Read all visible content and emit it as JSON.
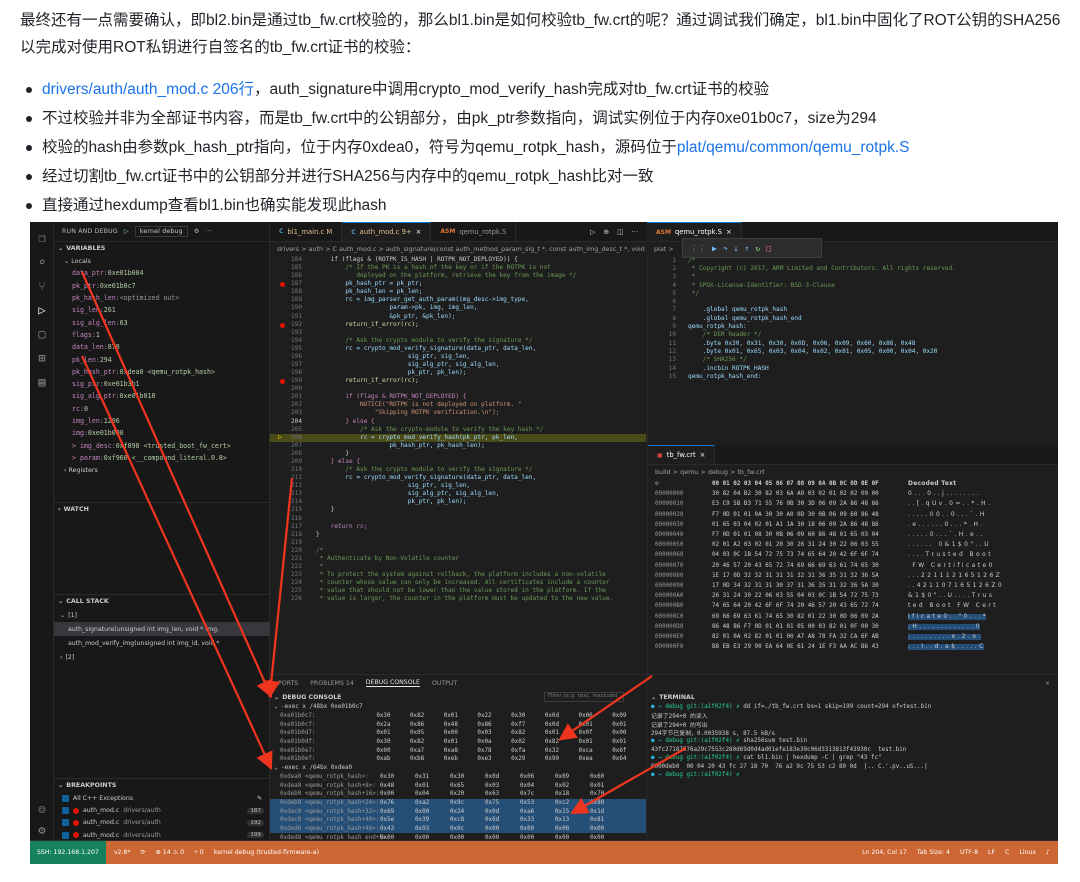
{
  "article": {
    "intro": "最终还有一点需要确认，即bl2.bin是通过tb_fw.crt校验的，那么bl1.bin是如何校验tb_fw.crt的呢？通过调试我们确定，bl1.bin中固化了ROT公钥的SHA256以完成对使用ROT私钥进行自签名的tb_fw.crt证书的校验：",
    "bullets": [
      {
        "link": "drivers/auth/auth_mod.c 206行",
        "text": "，auth_signature中调用crypto_mod_verify_hash完成对tb_fw.crt证书的校验",
        "link2": "",
        "tail": ""
      },
      {
        "link": "",
        "text": "不过校验并非为全部证书内容，而是tb_fw.crt中的公钥部分，由pk_ptr参数指向，调试实例位于内存0xe01b0c7，size为294",
        "link2": "",
        "tail": ""
      },
      {
        "link": "",
        "text": "校验的hash由参数pk_hash_ptr指向，位于内存0xdea0，符号为qemu_rotpk_hash，源码位于",
        "link2": "plat/qemu/common/qemu_rotpk.S",
        "tail": ""
      },
      {
        "link": "",
        "text": "经过切割tb_fw.crt证书中的公钥部分并进行SHA256与内存中的qemu_rotpk_hash比对一致",
        "link2": "",
        "tail": ""
      },
      {
        "link": "",
        "text": "直接通过hexdump查看bl1.bin也确实能发现此hash",
        "link2": "",
        "tail": ""
      }
    ]
  },
  "ide": {
    "run_label": "RUN AND DEBUG",
    "config": "kernel debug",
    "variables_title": "VARIABLES",
    "locals_title": "Locals",
    "locals": [
      {
        "n": "data_ptr",
        "v": "0xe01b004"
      },
      {
        "n": "pk_ptr",
        "v": "0xe01b0c7"
      },
      {
        "n": "pk_hash_len",
        "v": "<optimized out>"
      },
      {
        "n": "sig_len",
        "v": "261"
      },
      {
        "n": "sig_alg_len",
        "v": "63"
      },
      {
        "n": "flags",
        "v": "1"
      },
      {
        "n": "data_len",
        "v": "878"
      },
      {
        "n": "pk_len",
        "v": "294"
      },
      {
        "n": "pk_hash_ptr",
        "v": "0xdea0 <qemu_rotpk_hash>"
      },
      {
        "n": "sig_ptr",
        "v": "0xe01b3b1"
      },
      {
        "n": "sig_alg_ptr",
        "v": "0xe01b018"
      },
      {
        "n": "rc",
        "v": "0"
      },
      {
        "n": "img_len",
        "v": "1206"
      },
      {
        "n": "img",
        "v": "0xe01b000"
      },
      {
        "n": "> img_desc",
        "v": "0xf898 <trusted_boot_fw_cert>"
      },
      {
        "n": "> param",
        "v": "0xf960 <__compound_literal.0.8>"
      }
    ],
    "registers": "Registers",
    "watch": "WATCH",
    "callstack_title": "CALL STACK",
    "callstack_thread": "[1]",
    "callstack": [
      "auth_signature(unsigned int img_len, void * img,",
      "auth_mod_verify_img(unsigned int img_id, void *"
    ],
    "callstack_thread2": "[2]",
    "breakpoints_title": "BREAKPOINTS",
    "breakpoints": [
      {
        "label": "All C++ Exceptions",
        "path": "",
        "line": ""
      },
      {
        "label": "auth_mod.c",
        "path": "drivers/auth",
        "line": "187"
      },
      {
        "label": "auth_mod.c",
        "path": "drivers/auth",
        "line": "192"
      },
      {
        "label": "auth_mod.c",
        "path": "drivers/auth",
        "line": "199"
      },
      {
        "label": "auth_mod.c",
        "path": "drivers/auth",
        "line": "206"
      }
    ],
    "tabs": [
      "bl1_main.c M",
      "auth_mod.c 9+",
      "qemu_rotpk.S"
    ],
    "tab_right": "qemu_rotpk.S",
    "breadcrumb": "drivers > auth > C auth_mod.c > auth_signature(const auth_method_param_sig_t *, const auth_img_desc_t *, void *,",
    "breadcrumb_right": "plat >",
    "code": [
      {
        "n": "184",
        "t": "    if (flags & (ROTPK_IS_HASH | ROTPK_NOT_DEPLOYED)) {",
        "c": "pl"
      },
      {
        "n": "185",
        "t": "        /* If the PK is a hash of the key or if the ROTPK is not",
        "c": "cm"
      },
      {
        "n": "186",
        "t": "           deployed on the platform, retrieve the key from the image */",
        "c": "cm"
      },
      {
        "n": "187",
        "t": "        pk_hash_ptr = pk_ptr;",
        "c": "id",
        "bp": true
      },
      {
        "n": "188",
        "t": "        pk_hash_len = pk_len;",
        "c": "id"
      },
      {
        "n": "189",
        "t": "        rc = img_parser_get_auth_param(img_desc->img_type,",
        "c": "id"
      },
      {
        "n": "190",
        "t": "                    param->pk, img, img_len,",
        "c": "id"
      },
      {
        "n": "191",
        "t": "                    &pk_ptr, &pk_len);",
        "c": "id"
      },
      {
        "n": "192",
        "t": "        return_if_error(rc);",
        "c": "fn",
        "bp": true
      },
      {
        "n": "193",
        "t": "",
        "c": "pl"
      },
      {
        "n": "194",
        "t": "        /* Ask the crypto module to verify the signature */",
        "c": "cm"
      },
      {
        "n": "195",
        "t": "        rc = crypto_mod_verify_signature(data_ptr, data_len,",
        "c": "id"
      },
      {
        "n": "196",
        "t": "                         sig_ptr, sig_len,",
        "c": "id"
      },
      {
        "n": "197",
        "t": "                         sig_alg_ptr, sig_alg_len,",
        "c": "id"
      },
      {
        "n": "198",
        "t": "                         pk_ptr, pk_len);",
        "c": "id"
      },
      {
        "n": "199",
        "t": "        return_if_error(rc);",
        "c": "fn",
        "bp": true
      },
      {
        "n": "200",
        "t": "",
        "c": "pl"
      },
      {
        "n": "201",
        "t": "        if (flags & ROTPK_NOT_DEPLOYED) {",
        "c": "kw"
      },
      {
        "n": "202",
        "t": "            NOTICE(\"ROTPK is not deployed on platform. \"",
        "c": "st"
      },
      {
        "n": "203",
        "t": "                \"Skipping ROTPK verification.\\n\");",
        "c": "st"
      },
      {
        "n": "204",
        "t": "        } else {",
        "c": "kw"
      },
      {
        "n": "205",
        "t": "            /* Ask the crypto-module to verify the key hash */",
        "c": "cm"
      },
      {
        "n": "206",
        "t": "            rc = crypto_mod_verify_hash(pk_ptr, pk_len,",
        "c": "id",
        "hl": true
      },
      {
        "n": "207",
        "t": "                    pk_hash_ptr, pk_hash_len);",
        "c": "id"
      },
      {
        "n": "208",
        "t": "        }",
        "c": "pl"
      },
      {
        "n": "209",
        "t": "    } else {",
        "c": "kw"
      },
      {
        "n": "210",
        "t": "        /* Ask the crypto module to verify the signature */",
        "c": "cm"
      },
      {
        "n": "211",
        "t": "        rc = crypto_mod_verify_signature(data_ptr, data_len,",
        "c": "id"
      },
      {
        "n": "212",
        "t": "                         sig_ptr, sig_len,",
        "c": "id"
      },
      {
        "n": "213",
        "t": "                         sig_alg_ptr, sig_alg_len,",
        "c": "id"
      },
      {
        "n": "214",
        "t": "                         pk_ptr, pk_len);",
        "c": "id"
      },
      {
        "n": "215",
        "t": "    }",
        "c": "pl"
      },
      {
        "n": "216",
        "t": "",
        "c": "pl"
      },
      {
        "n": "217",
        "t": "    return rc;",
        "c": "kw"
      },
      {
        "n": "218",
        "t": "}",
        "c": "pl"
      },
      {
        "n": "219",
        "t": "",
        "c": "pl"
      },
      {
        "n": "220",
        "t": "/*",
        "c": "cm"
      },
      {
        "n": "221",
        "t": " * Authenticate by Non-Volatile counter",
        "c": "cm"
      },
      {
        "n": "222",
        "t": " *",
        "c": "cm"
      },
      {
        "n": "223",
        "t": " * To protect the system against rollback, the platform includes a non-volatile",
        "c": "cm"
      },
      {
        "n": "224",
        "t": " * counter whose value can only be increased. All certificates include a counter",
        "c": "cm"
      },
      {
        "n": "225",
        "t": " * value that should not be lower than the value stored in the platform. If the",
        "c": "cm"
      },
      {
        "n": "226",
        "t": " * value is larger, the counter in the platform must be updated to the new value.",
        "c": "cm"
      }
    ],
    "asm": [
      {
        "n": "1",
        "t": "/*",
        "c": "cm"
      },
      {
        "n": "2",
        "t": " * Copyright (c) 2017, ARM Limited and Contributors. All rights reserved.",
        "c": "cm"
      },
      {
        "n": "3",
        "t": " *",
        "c": "cm"
      },
      {
        "n": "4",
        "t": " * SPDX-License-Identifier: BSD-3-Clause",
        "c": "cm"
      },
      {
        "n": "5",
        "t": " */",
        "c": "cm"
      },
      {
        "n": "6",
        "t": "",
        "c": "pl"
      },
      {
        "n": "7",
        "t": "    .global qemu_rotpk_hash",
        "c": "id"
      },
      {
        "n": "8",
        "t": "    .global qemu_rotpk_hash_end",
        "c": "id"
      },
      {
        "n": "9",
        "t": "qemu_rotpk_hash:",
        "c": "id"
      },
      {
        "n": "10",
        "t": "    /* DER header */",
        "c": "cm"
      },
      {
        "n": "11",
        "t": "    .byte 0x30, 0x31, 0x30, 0x0D, 0x06, 0x09, 0x60, 0x86, 0x48",
        "c": "id"
      },
      {
        "n": "12",
        "t": "    .byte 0x01, 0x65, 0x03, 0x04, 0x02, 0x01, 0x05, 0x00, 0x04, 0x20",
        "c": "id"
      },
      {
        "n": "13",
        "t": "    /* SHA256 */",
        "c": "cm"
      },
      {
        "n": "14",
        "t": "    .incbin ROTPK_HASH",
        "c": "id"
      },
      {
        "n": "15",
        "t": "qemu_rotpk_hash_end:",
        "c": "id"
      }
    ],
    "hex_tab": "tb_fw.crt",
    "hex_breadcrumb": "build > qemu > debug > tb_fw.crt",
    "hex_header": {
      "o": "",
      "b": "00 01 02 03 04 05 06 07 08 09 0A 0B 0C 0D 0E 0F",
      "t": "Decoded Text"
    },
    "hex": [
      {
        "o": "00000000",
        "b": "30 82 04 B2 30 82 03 6A A0 03 02 01 02 02 09 00",
        "t": "0 . . . 0 . . j . . . . . . . ."
      },
      {
        "o": "00000010",
        "b": "E3 C9 5B B3 71 55 76 0B 30 3D 06 09 2A 86 48 86",
        "t": ". . [ . q U v . 0 = . . * . H ."
      },
      {
        "o": "00000020",
        "b": "F7 0D 01 01 0A 30 30 A0 0D 30 0B 06 09 60 86 48",
        "t": ". . . . . 0 0 . . 0 . . . ` . H"
      },
      {
        "o": "00000030",
        "b": "01 65 03 04 02 01 A1 1A 30 18 06 09 2A 86 48 86",
        "t": ". e . . . . . . 0 . . . * . H ."
      },
      {
        "o": "00000040",
        "b": "F7 0D 01 01 08 30 0B 06 09 60 86 48 01 65 03 04",
        "t": ". . . . . 0 . . . ` . H . e . ."
      },
      {
        "o": "00000050",
        "b": "02 01 A2 03 02 01 20 30 26 31 24 30 22 06 03 55",
        "t": ". . . . . .   0 & 1 $ 0 \" . . U"
      },
      {
        "o": "00000060",
        "b": "04 03 0C 1B 54 72 75 73 74 65 64 20 42 6F 6F 74",
        "t": ". . . . T r u s t e d   B o o t"
      },
      {
        "o": "00000070",
        "b": "20 46 57 20 43 65 72 74 69 66 69 63 61 74 65 30",
        "t": "  F W   C e r t i f i c a t e 0"
      },
      {
        "o": "00000080",
        "b": "1E 17 0D 32 32 31 31 31 32 31 36 35 31 32 36 5A",
        "t": ". . . 2 2 1 1 1 2 1 6 5 1 2 6 Z"
      },
      {
        "o": "00000090",
        "b": "17 0D 34 32 31 31 30 37 31 36 35 31 32 36 5A 30",
        "t": ". . 4 2 1 1 0 7 1 6 5 1 2 6 Z 0"
      },
      {
        "o": "000000A0",
        "b": "26 31 24 30 22 06 03 55 04 03 0C 1B 54 72 75 73",
        "t": "& 1 $ 0 \" . . U . . . . T r u s"
      },
      {
        "o": "000000B0",
        "b": "74 65 64 20 42 6F 6F 74 20 46 57 20 43 65 72 74",
        "t": "t e d   B o o t   F W   C e r t"
      },
      {
        "o": "000000C0",
        "b": "69 66 69 63 61 74 65 30 82 01 22 30 0D 06 09 2A",
        "t": "i f i c a t e 0 . . \" 0 . . . *"
      },
      {
        "o": "000000D0",
        "b": "86 48 86 F7 0D 01 01 01 05 00 03 82 01 0F 00 30",
        "t": ". H . . . . . . . . . . . . . 0"
      },
      {
        "o": "000000E0",
        "b": "82 01 0A 02 82 01 01 00 A7 A8 78 FA 32 CA 6F AB",
        "t": ". . . . . . . . . . x . 2 . o ."
      },
      {
        "o": "000000F0",
        "b": "B8 EB E3 29 90 EA 64 0E 61 24 1E F3 AA AC B6 43",
        "t": ". . . ) . . d . a $ . . . . . C"
      }
    ],
    "panel_tabs": [
      "PORTS",
      "PROBLEMS 14",
      "DEBUG CONSOLE",
      "OUTPUT"
    ],
    "debug_console_title": "DEBUG CONSOLE",
    "filter_placeholder": "Filter (e.g. text, !exclude)",
    "dbg_cmd1": "-exec x /48bx 0xe01b0c7",
    "dbg1": [
      [
        "0xe01b0c7:",
        "0x30",
        "0x82",
        "0x01",
        "0x22",
        "0x30",
        "0x0d",
        "0x06",
        "0x09"
      ],
      [
        "0xe01b0cf:",
        "0x2a",
        "0x86",
        "0x48",
        "0x86",
        "0xf7",
        "0x0d",
        "0x01",
        "0x01"
      ],
      [
        "0xe01b0d7:",
        "0x01",
        "0x05",
        "0x00",
        "0x03",
        "0x82",
        "0x01",
        "0x0f",
        "0x00"
      ],
      [
        "0xe01b0df:",
        "0x30",
        "0x82",
        "0x01",
        "0x0a",
        "0x02",
        "0x82",
        "0x01",
        "0x01"
      ],
      [
        "0xe01b0e7:",
        "0x00",
        "0xa7",
        "0xa8",
        "0x78",
        "0xfa",
        "0x32",
        "0xca",
        "0x6f"
      ],
      [
        "0xe01b0ef:",
        "0xab",
        "0xb8",
        "0xeb",
        "0xe3",
        "0x29",
        "0x90",
        "0xea",
        "0x64"
      ]
    ],
    "dbg_cmd2": "-exec x /64bx 0xdea0",
    "dbg2": [
      [
        "0xdea0 <qemu_rotpk_hash>:",
        "0x30",
        "0x31",
        "0x30",
        "0x0d",
        "0x06",
        "0x09",
        "0x60"
      ],
      [
        "0xdea8 <qemu_rotpk_hash+8>:",
        "0x48",
        "0x01",
        "0x65",
        "0x03",
        "0x04",
        "0x02",
        "0x01"
      ],
      [
        "0xdeb0 <qemu_rotpk_hash+16>:",
        "0x00",
        "0x04",
        "0x20",
        "0x63",
        "0x7c",
        "0x18",
        "0x70"
      ],
      [
        "0xdeb8 <qemu_rotpk_hash+24>:",
        "0x76",
        "0xa2",
        "0x9c",
        "0x75",
        "0x53",
        "0xc2",
        "0x80"
      ],
      [
        "0xdec0 <qemu_rotpk_hash+32>:",
        "0x69",
        "0x00",
        "0x24",
        "0x0d",
        "0xa6",
        "0x15",
        "0x1d"
      ],
      [
        "0xdec8 <qemu_rotpk_hash+40>:",
        "0x5e",
        "0x39",
        "0xc8",
        "0x6d",
        "0x33",
        "0x13",
        "0x81"
      ],
      [
        "0xded0 <qemu_rotpk_hash+48>:",
        "0x43",
        "0x93",
        "0x0c",
        "0x00",
        "0x00",
        "0x00",
        "0x00"
      ],
      [
        "0xded8 <qemu_rotpk_hash_end+5>:",
        "0x00",
        "0x00",
        "0x00",
        "0x00",
        "0x00",
        "0x00",
        "0x00"
      ]
    ],
    "terminal_title": "TERMINAL",
    "terminal": [
      {
        "p": "debug git:(a1f02f4) ✗",
        "c": "dd if=./tb_fw.crt bs=1 skip=199 count=294 of=test.bin"
      },
      {
        "p": "",
        "c": "记录了294+0 的读入"
      },
      {
        "p": "",
        "c": "记录了294+0 的写出"
      },
      {
        "p": "",
        "c": "294字节已复制，0.0035938 s, 87.5 kB/s"
      },
      {
        "p": "debug git:(a1f02f4) ✗",
        "c": "sha256sum test.bin"
      },
      {
        "p": "",
        "c": "43fc27187076a29c7553c280d69d0d4ad01efe183e39c06d3313813f43930c  test.bin"
      },
      {
        "p": "debug git:(a1f02f4) ✗",
        "c": "cat bl1.bin | hexdump -C | grep \"43 fc\""
      },
      {
        "p": "",
        "c": "0000deb0  00 04 20 43 fc 27 18 70  76 a2 9c 75 53 c2 80 0d  |.. C.'.pv..uS...|"
      },
      {
        "p": "debug git:(a1f02f4) ✗",
        "c": ""
      }
    ],
    "status": {
      "ssh": "SSH: 192.168.1.207",
      "branch": "v2.8*",
      "problems": "⊗ 14 ⚠ 0",
      "ports": "⑂ 0",
      "debug": "kernel debug (trusted-firmware-a)",
      "pos": "Ln 204, Col 17",
      "tab": "Tab Size: 4",
      "enc": "UTF-8",
      "eol": "LF",
      "lang": "C",
      "os": "Linux"
    }
  }
}
